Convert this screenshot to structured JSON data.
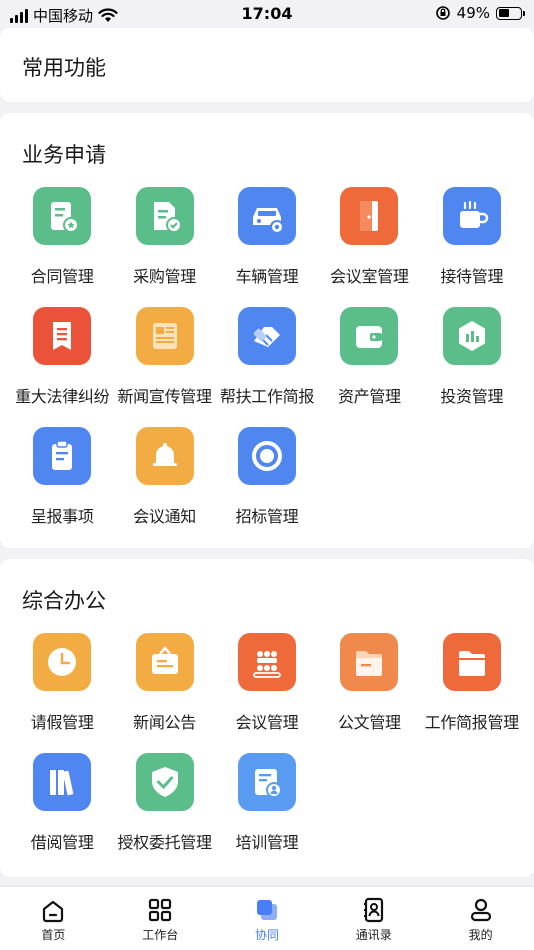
{
  "status": {
    "carrier": "中国移动",
    "time": "17:04",
    "battery": "49%"
  },
  "sections": {
    "common": {
      "title": "常用功能"
    },
    "business": {
      "title": "业务申请",
      "items": [
        {
          "label": "合同管理",
          "icon": "contract-icon",
          "color": "#5bbd8a"
        },
        {
          "label": "采购管理",
          "icon": "purchase-icon",
          "color": "#5bbd8a"
        },
        {
          "label": "车辆管理",
          "icon": "car-icon",
          "color": "#4f86f0"
        },
        {
          "label": "会议室管理",
          "icon": "door-icon",
          "color": "#ef6a3a"
        },
        {
          "label": "接待管理",
          "icon": "cup-icon",
          "color": "#4f86f0"
        },
        {
          "label": "重大法律纠纷",
          "icon": "legal-doc-icon",
          "color": "#ea5339"
        },
        {
          "label": "新闻宣传管理",
          "icon": "newspaper-icon",
          "color": "#f3ac43"
        },
        {
          "label": "帮扶工作简报",
          "icon": "handshake-icon",
          "color": "#4f86f0"
        },
        {
          "label": "资产管理",
          "icon": "wallet-icon",
          "color": "#5bbd8a"
        },
        {
          "label": "投资管理",
          "icon": "investment-icon",
          "color": "#5bbd8a"
        },
        {
          "label": "呈报事项",
          "icon": "clipboard-icon",
          "color": "#4f86f0"
        },
        {
          "label": "会议通知",
          "icon": "bell-icon",
          "color": "#f3ac43"
        },
        {
          "label": "招标管理",
          "icon": "target-icon",
          "color": "#4f86f0"
        }
      ]
    },
    "office": {
      "title": "综合办公",
      "items": [
        {
          "label": "请假管理",
          "icon": "clock-icon",
          "color": "#f3ac43"
        },
        {
          "label": "新闻公告",
          "icon": "announcement-icon",
          "color": "#f3ac43"
        },
        {
          "label": "会议管理",
          "icon": "meeting-icon",
          "color": "#ef6a3a"
        },
        {
          "label": "公文管理",
          "icon": "document-folder-icon",
          "color": "#f08a4c"
        },
        {
          "label": "工作简报管理",
          "icon": "folder-icon",
          "color": "#ef6a3a"
        },
        {
          "label": "借阅管理",
          "icon": "books-icon",
          "color": "#4f86f0"
        },
        {
          "label": "授权委托管理",
          "icon": "shield-check-icon",
          "color": "#5bbd8a"
        },
        {
          "label": "培训管理",
          "icon": "training-icon",
          "color": "#5a9bf2"
        }
      ]
    }
  },
  "tabbar": {
    "items": [
      {
        "label": "首页",
        "icon": "home-icon"
      },
      {
        "label": "工作台",
        "icon": "grid-icon"
      },
      {
        "label": "协同",
        "icon": "cooperate-icon",
        "active": true
      },
      {
        "label": "通讯录",
        "icon": "contacts-icon"
      },
      {
        "label": "我的",
        "icon": "profile-icon"
      }
    ],
    "active_color": "#4a7ef5"
  }
}
